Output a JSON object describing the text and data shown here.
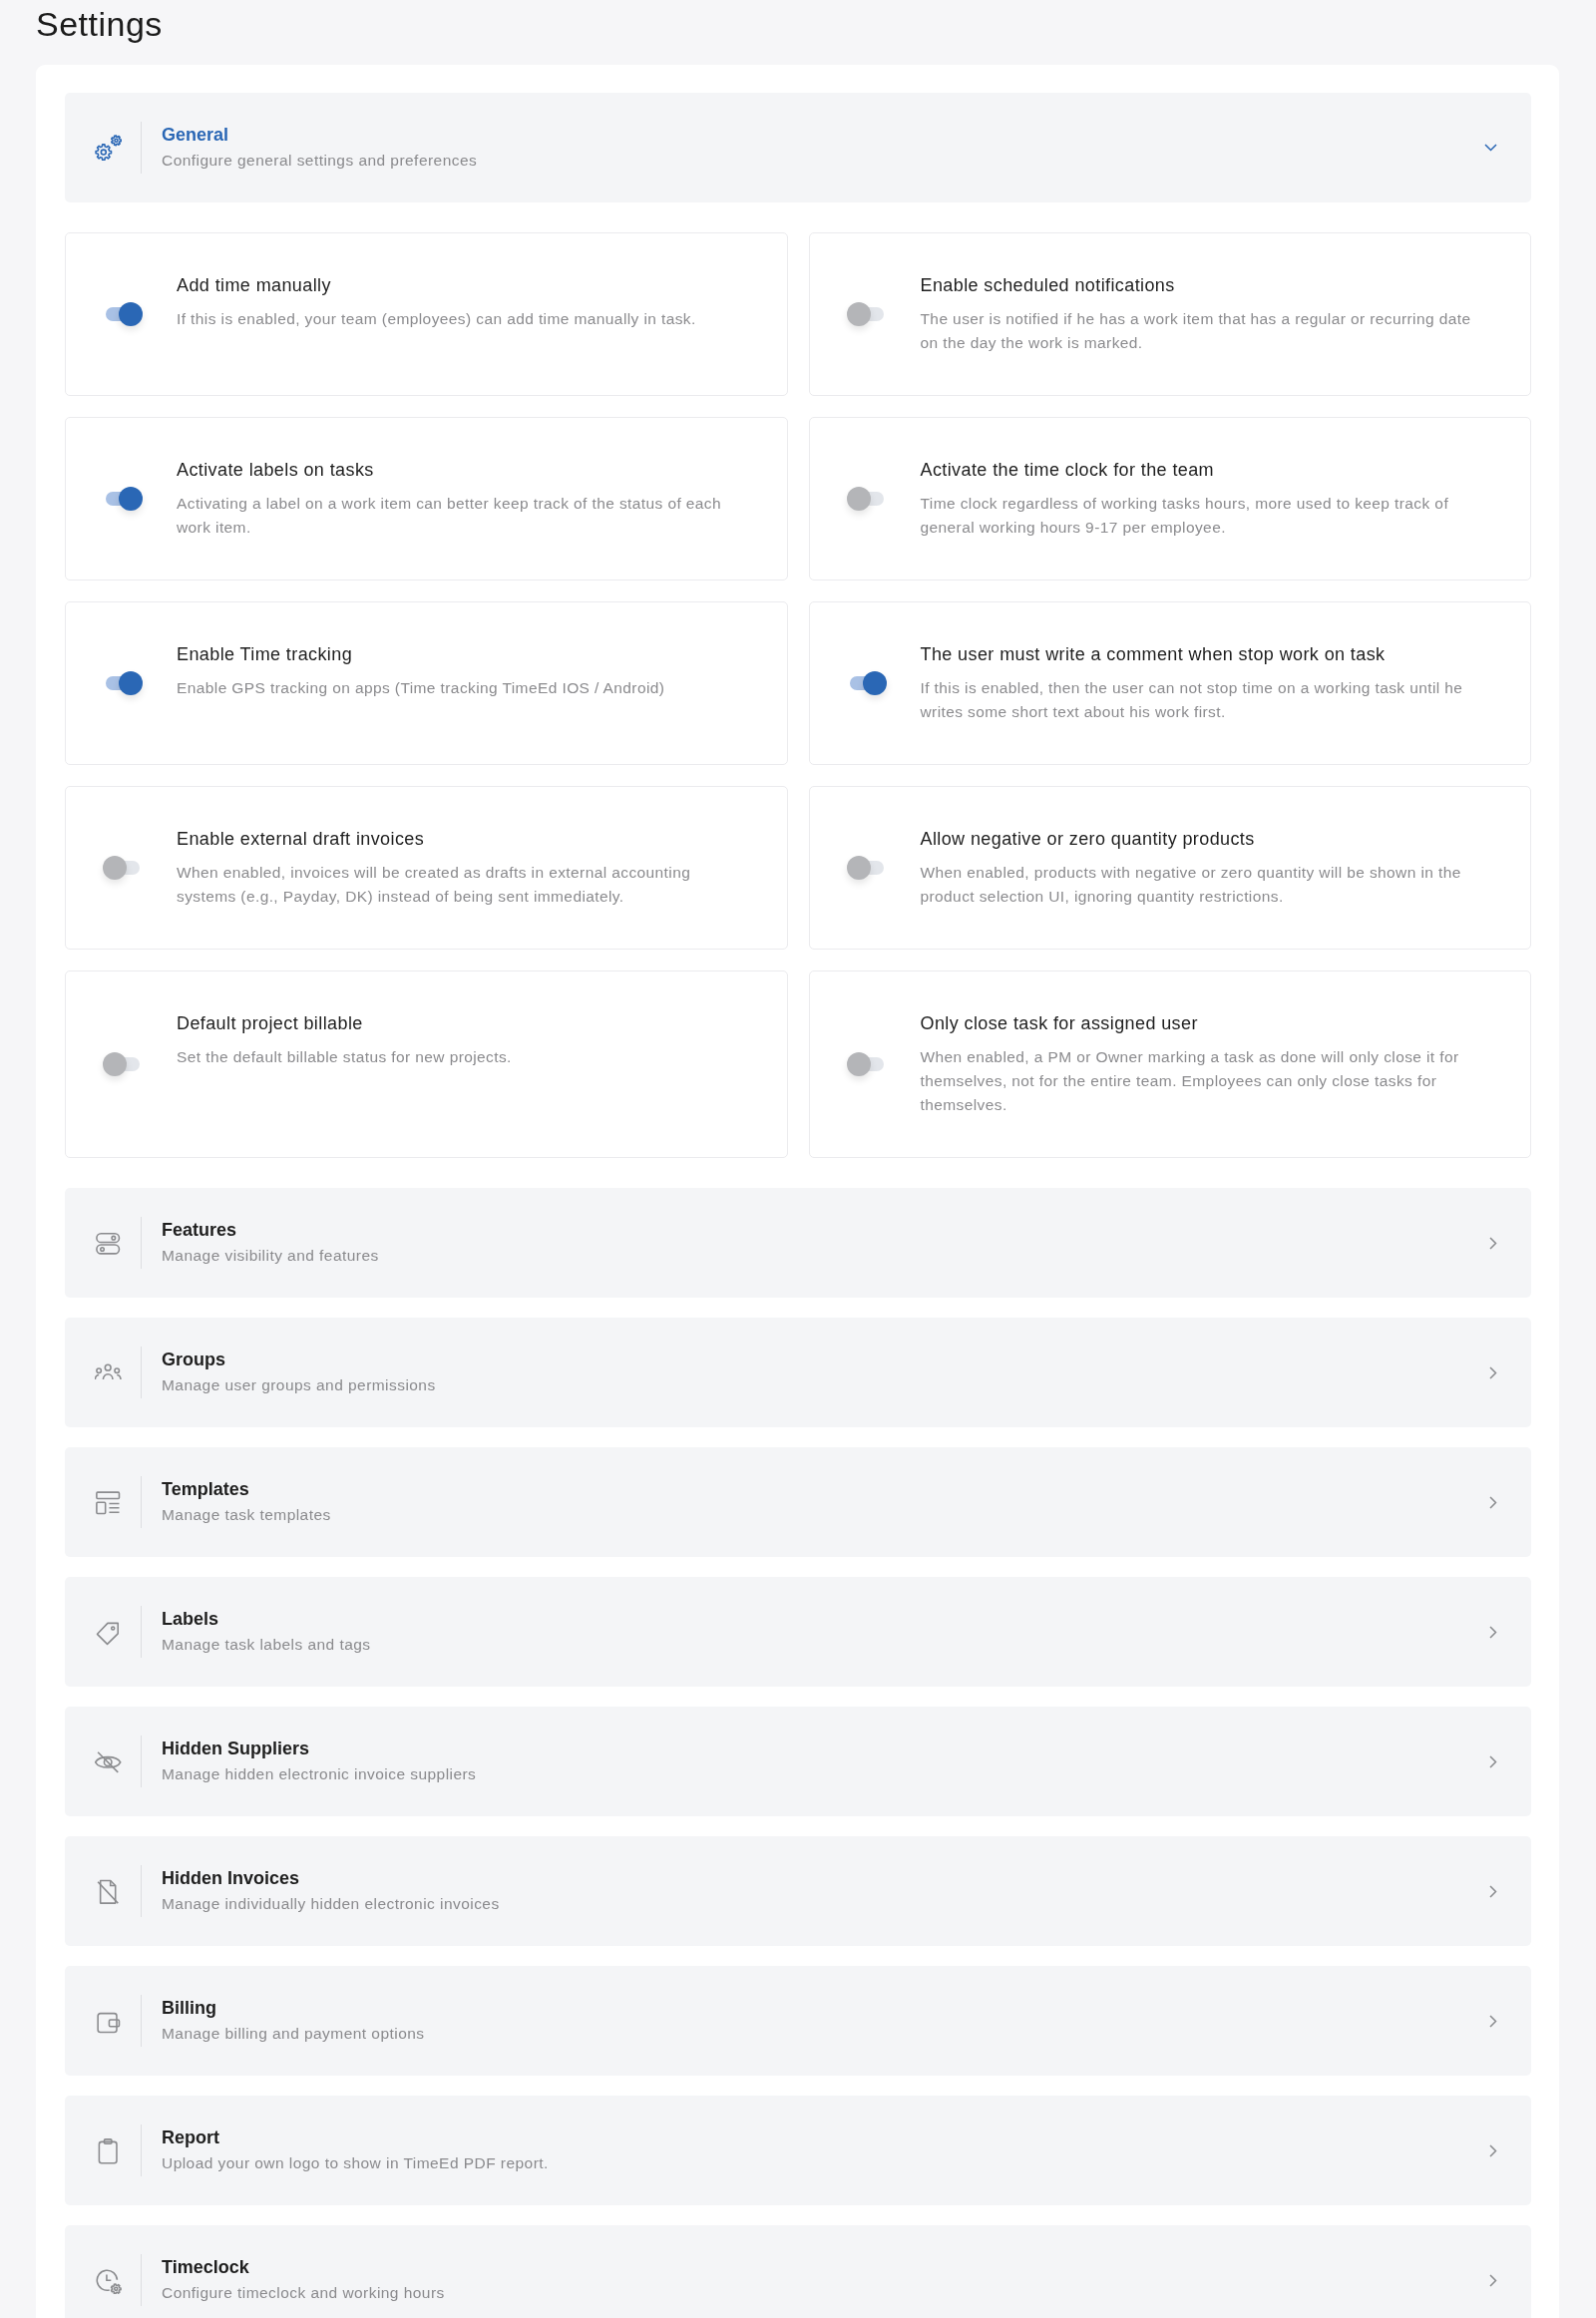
{
  "page": {
    "title": "Settings"
  },
  "sections": [
    {
      "title": "General",
      "description": "Configure general settings and preferences",
      "expanded": true,
      "settings": [
        {
          "title": "Add time manually",
          "description": "If this is enabled, your team (employees) can add time manually in task.",
          "on": true
        },
        {
          "title": "Enable scheduled notifications",
          "description": "The user is notified if he has a work item that has a regular or recurring date on the day the work is marked.",
          "on": false
        },
        {
          "title": "Activate labels on tasks",
          "description": "Activating a label on a work item can better keep track of the status of each work item.",
          "on": true
        },
        {
          "title": "Activate the time clock for the team",
          "description": "Time clock regardless of working tasks hours, more used to keep track of general working hours 9-17 per employee.",
          "on": false
        },
        {
          "title": "Enable Time tracking",
          "description": "Enable GPS tracking on apps (Time tracking TimeEd IOS / Android)",
          "on": true
        },
        {
          "title": "The user must write a comment when stop work on task",
          "description": "If this is enabled, then the user can not stop time on a working task until he writes some short text about his work first.",
          "on": true
        },
        {
          "title": "Enable external draft invoices",
          "description": "When enabled, invoices will be created as drafts in external accounting systems (e.g., Payday, DK) instead of being sent immediately.",
          "on": false
        },
        {
          "title": "Allow negative or zero quantity products",
          "description": "When enabled, products with negative or zero quantity will be shown in the product selection UI, ignoring quantity restrictions.",
          "on": false
        },
        {
          "title": "Default project billable",
          "description": "Set the default billable status for new projects.",
          "on": false
        },
        {
          "title": "Only close task for assigned user",
          "description": "When enabled, a PM or Owner marking a task as done will only close it for themselves, not for the entire team. Employees can only close tasks for themselves.",
          "on": false
        }
      ]
    },
    {
      "title": "Features",
      "description": "Manage visibility and features",
      "expanded": false
    },
    {
      "title": "Groups",
      "description": "Manage user groups and permissions",
      "expanded": false
    },
    {
      "title": "Templates",
      "description": "Manage task templates",
      "expanded": false
    },
    {
      "title": "Labels",
      "description": "Manage task labels and tags",
      "expanded": false
    },
    {
      "title": "Hidden Suppliers",
      "description": "Manage hidden electronic invoice suppliers",
      "expanded": false
    },
    {
      "title": "Hidden Invoices",
      "description": "Manage individually hidden electronic invoices",
      "expanded": false
    },
    {
      "title": "Billing",
      "description": "Manage billing and payment options",
      "expanded": false
    },
    {
      "title": "Report",
      "description": "Upload your own logo to show in TimeEd PDF report.",
      "expanded": false
    },
    {
      "title": "Timeclock",
      "description": "Configure timeclock and working hours",
      "expanded": false
    }
  ]
}
